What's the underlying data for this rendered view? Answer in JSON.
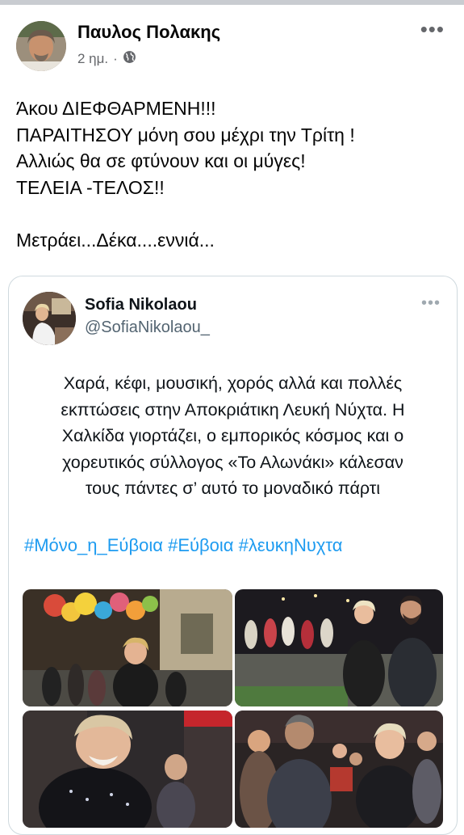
{
  "post": {
    "author": "Παυλος Πολακης",
    "time": "2 ημ.",
    "separator": "·",
    "audience_icon": "globe-icon",
    "more_icon": "more-options-icon",
    "lines": [
      "Άκου ΔΙΕΦΘΑΡΜΕΝΗ!!!",
      "ΠΑΡΑΙΤΗΣΟΥ μόνη σου μέχρι την Τρίτη !",
      "Αλλιώς θα σε φτύνουν και οι  μύγες!",
      "ΤΕΛΕΙΑ -ΤΕΛΟΣ!!",
      "Μετράει...Δέκα....εννιά..."
    ]
  },
  "quoted_tweet": {
    "name": "Sofia Nikolaou",
    "handle": "@SofiaNikolaou_",
    "lines": [
      "Χαρά, κέφι, μουσική, χορός αλλά και πολλές",
      "εκπτώσεις στην Αποκριάτικη Λευκή Νύχτα. Η",
      "Χαλκίδα γιορτάζει, ο εμπορικός κόσμος και ο",
      "χορευτικός σύλλογος «Το Αλωνάκι» κάλεσαν",
      "τους πάντες σ’ αυτό το μοναδικό πάρτι"
    ],
    "hashtags": [
      "#Μόνο_η_Εύβοια",
      "#Εύβοια",
      "#λευκηΝυχτα"
    ],
    "photos": [
      "photo-1",
      "photo-2",
      "photo-3",
      "photo-4"
    ]
  },
  "colors": {
    "link": "#1d9bf0",
    "secondary_text": "#65676b",
    "card_border": "#cfd9de"
  }
}
